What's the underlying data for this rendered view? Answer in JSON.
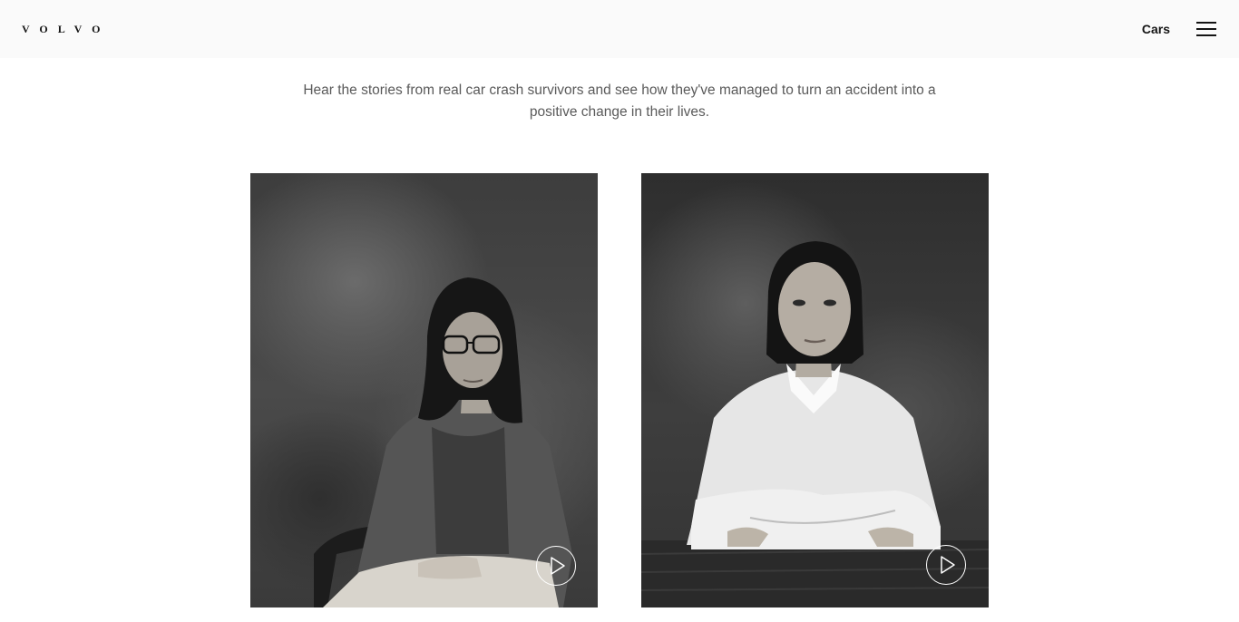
{
  "header": {
    "logo_text": "VOLVO",
    "nav_label": "Cars",
    "menu_icon": "hamburger-menu-icon"
  },
  "intro": {
    "text": "Hear the stories from real car crash survivors and see how they've managed to turn an accident into a positive change in their lives."
  },
  "stories": [
    {
      "image_description": "black and white portrait of a woman with glasses seated in a wooden chair",
      "play_icon": "play-icon"
    },
    {
      "image_description": "black and white portrait of a woman in a white shirt with arms crossed on a table",
      "play_icon": "play-icon"
    }
  ],
  "colors": {
    "header_bg": "#fafafa",
    "text_dark": "#141414",
    "text_muted": "#5a5a5a",
    "play_button": "#ffffff"
  }
}
